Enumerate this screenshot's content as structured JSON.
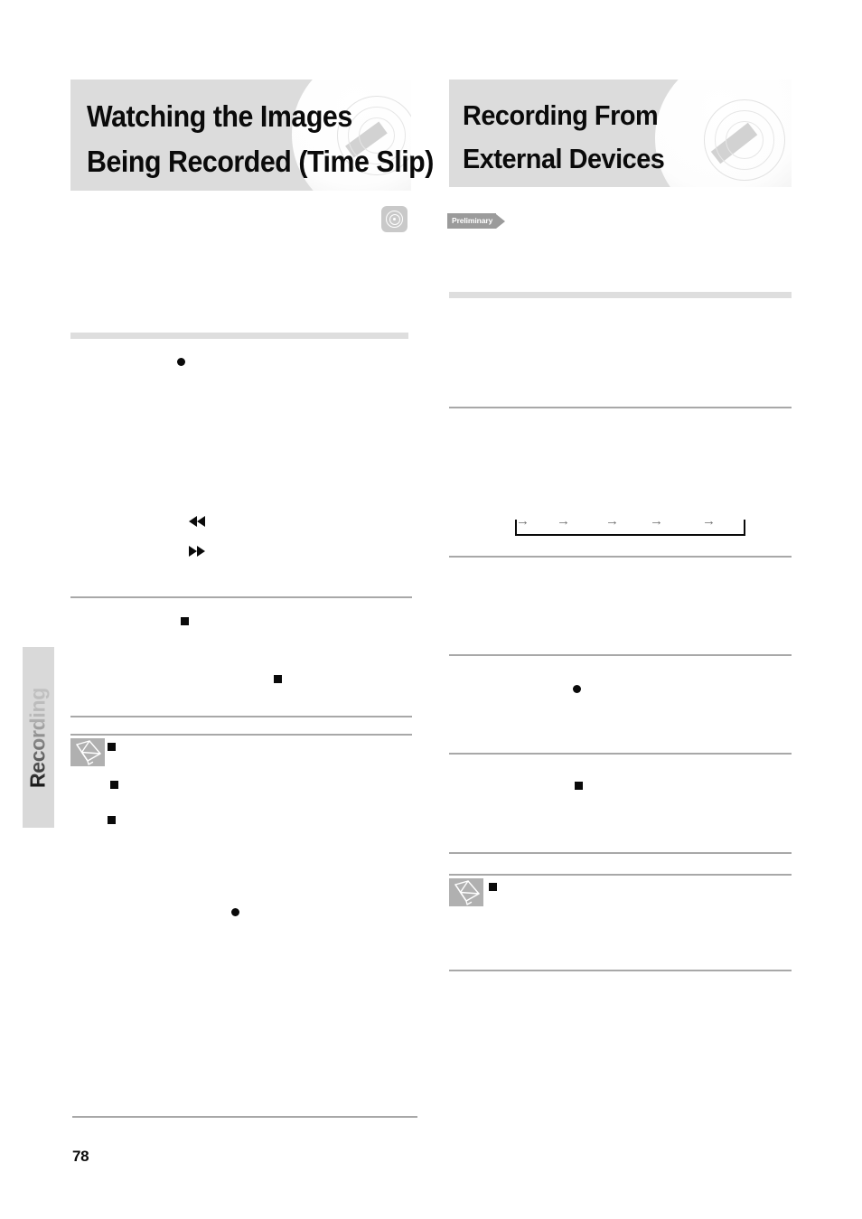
{
  "document": {
    "page_number": "78",
    "side_tab_label": "Recording"
  },
  "sections": {
    "left": {
      "heading_line1": "Watching the Images",
      "heading_line2": "Being Recorded (Time Slip)",
      "media_chip_icon": "disc-icon"
    },
    "right": {
      "heading_line1": "Recording From",
      "heading_line2": "External Devices",
      "badge_label": "Preliminary"
    }
  },
  "icons": {
    "note_icon": "pencil-note-icon",
    "rewind": "rewind-icon",
    "fast_forward": "fast-forward-icon",
    "flow_arrow": "→"
  },
  "colors": {
    "header_band": "#dcdcdc",
    "rule": "#a8a8a8",
    "rule_thick": "#dedede",
    "tag": "#9b9b9b",
    "note_icon_bg": "#b0b0b0",
    "side_tab_bg": "#d9d9d9",
    "text": "#0a0a0a"
  },
  "flow_arrow_count": 5
}
